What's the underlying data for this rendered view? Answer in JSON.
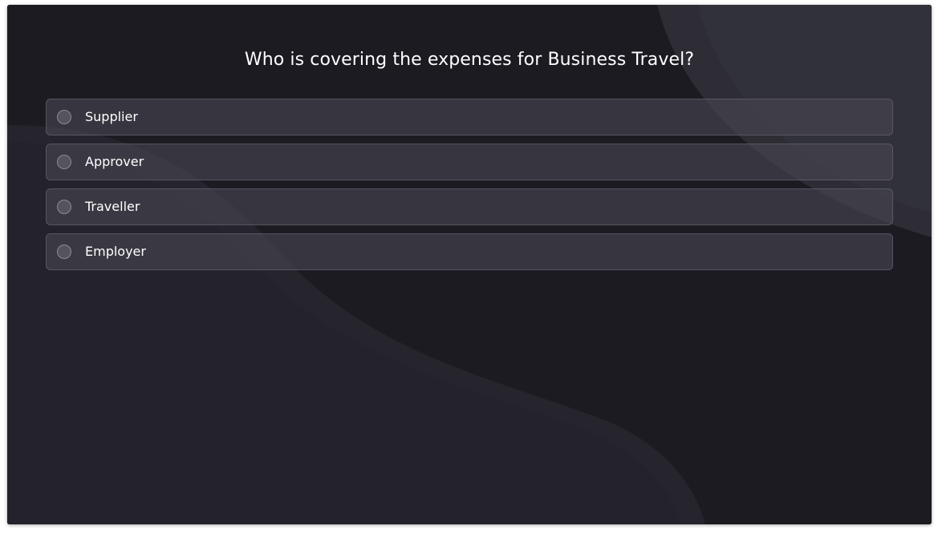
{
  "quiz": {
    "question": "Who is covering the expenses for Business Travel?",
    "options": [
      {
        "label": "Supplier"
      },
      {
        "label": "Approver"
      },
      {
        "label": "Traveller"
      },
      {
        "label": "Employer"
      }
    ]
  },
  "colors": {
    "background": "#1d1c23",
    "option_background": "#3d3c46",
    "text": "#ffffff"
  }
}
